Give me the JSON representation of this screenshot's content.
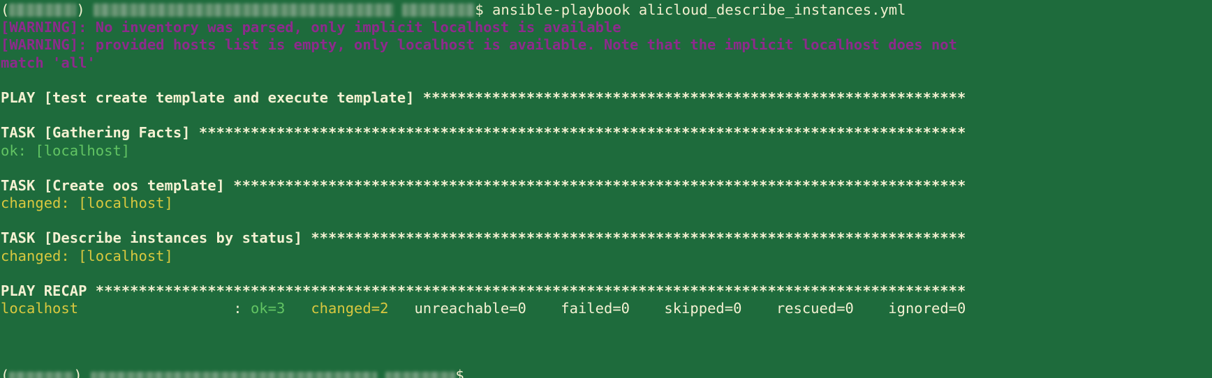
{
  "terminal": {
    "background_color": "#1e6b3c",
    "default_text_color": "#f2efcf",
    "warning_color": "#8e2a8c",
    "ok_color": "#62c463",
    "changed_color": "#d9c83f",
    "prompt_symbol": "$",
    "command": "ansible-playbook alicloud_describe_instances.yml",
    "lines": {
      "prompt_command": " ansible-playbook alicloud_describe_instances.yml",
      "warning1_tag": "[WARNING]:",
      "warning1_text": " No inventory was parsed, only implicit localhost is available",
      "warning2_tag": "[WARNING]:",
      "warning2_text": " provided hosts list is empty, only localhost is available. Note that the implicit localhost does not",
      "warning2_wrap": "match 'all'",
      "play_header": "PLAY [test create template and execute template] ***************************************************************",
      "task1_header": "TASK [Gathering Facts] *****************************************************************************************",
      "task1_result": "ok: [localhost]",
      "task2_header": "TASK [Create oos template] *************************************************************************************",
      "task2_result": "changed: [localhost]",
      "task3_header": "TASK [Describe instances by status] ****************************************************************************",
      "task3_result": "changed: [localhost]",
      "recap_header": "PLAY RECAP *****************************************************************************************************",
      "recap_host": "localhost                  ",
      "recap_colon": ": ",
      "recap_ok": "ok=3   ",
      "recap_changed": "changed=2   ",
      "recap_rest": "unreachable=0    failed=0    skipped=0    rescued=0    ignored=0",
      "bottom_prompt_symbol": "$"
    }
  }
}
